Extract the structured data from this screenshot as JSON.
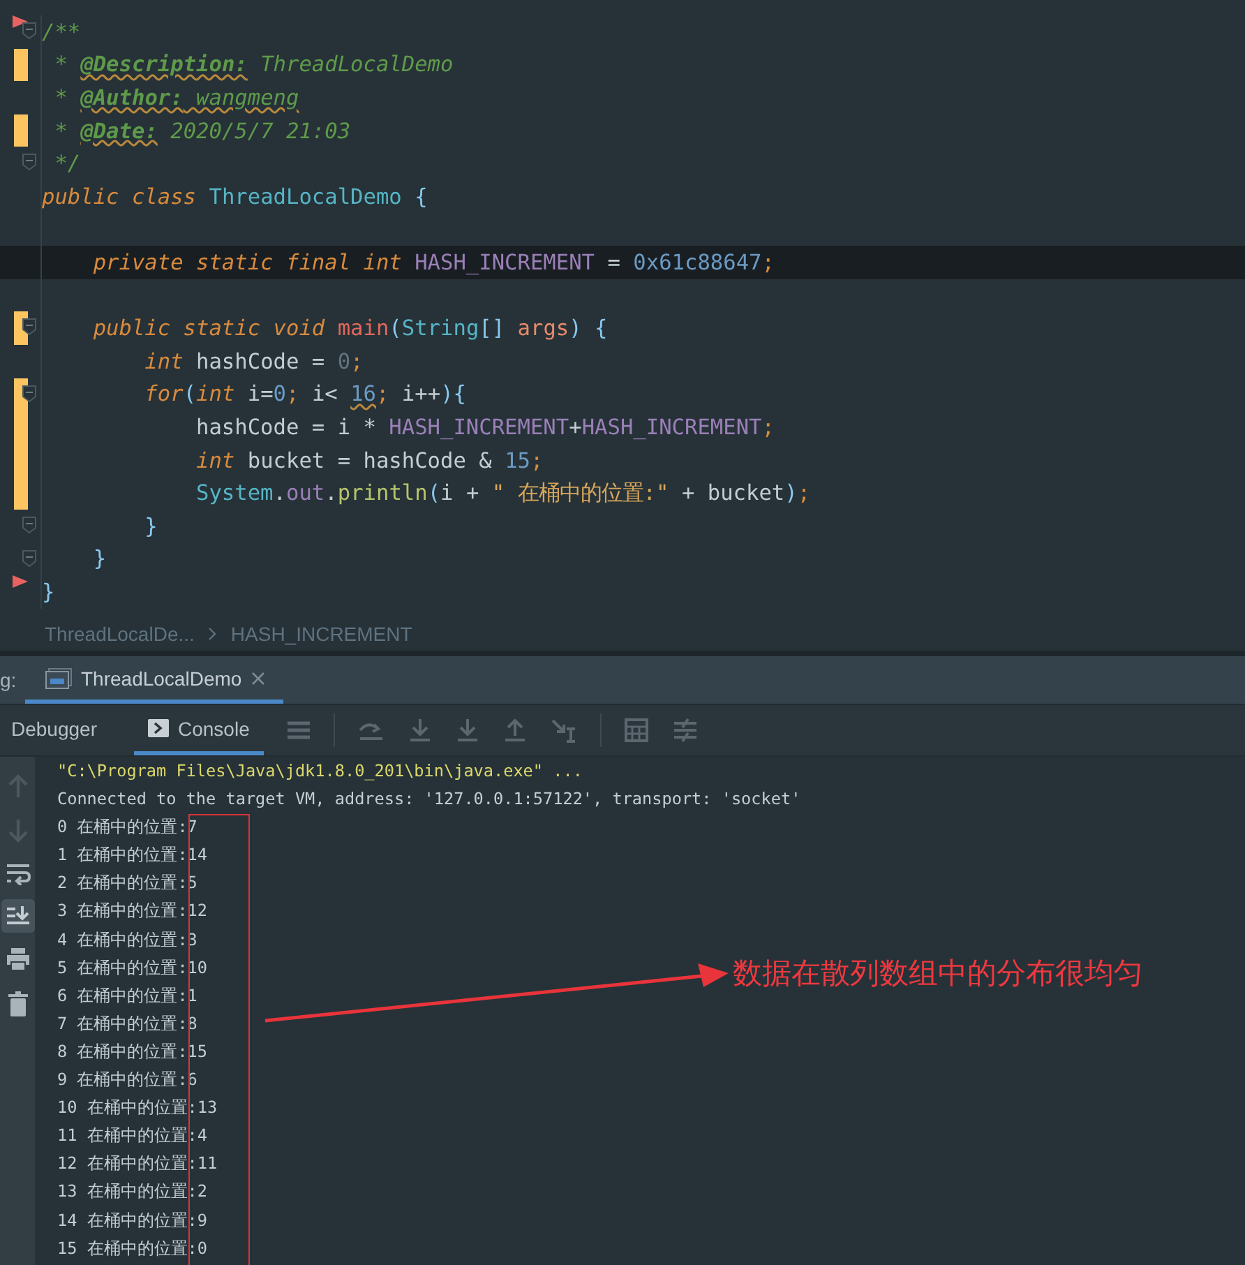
{
  "editor": {
    "lines": [
      {
        "changed": false,
        "fold": true,
        "flag": true,
        "current": false,
        "tokens": [
          {
            "kind": "comment",
            "text": "/**"
          }
        ]
      },
      {
        "changed": true,
        "fold": false,
        "flag": false,
        "current": false,
        "tokens": [
          {
            "kind": "comment",
            "text": " * "
          },
          {
            "kind": "doctag",
            "text": "@Description:"
          },
          {
            "kind": "comment",
            "text": " ThreadLocalDemo"
          }
        ]
      },
      {
        "changed": false,
        "fold": false,
        "flag": false,
        "current": false,
        "tokens": [
          {
            "kind": "comment",
            "text": " * "
          },
          {
            "kind": "doctag",
            "text": "@Author:"
          },
          {
            "kind": "comment-typo",
            "text": " wangmeng"
          }
        ]
      },
      {
        "changed": true,
        "fold": false,
        "flag": false,
        "current": false,
        "tokens": [
          {
            "kind": "comment",
            "text": " * "
          },
          {
            "kind": "doctag",
            "text": "@Date:"
          },
          {
            "kind": "comment",
            "text": " 2020/5/7 21:03"
          }
        ]
      },
      {
        "changed": false,
        "fold": true,
        "flag": false,
        "current": false,
        "tokens": [
          {
            "kind": "comment",
            "text": " */"
          }
        ]
      },
      {
        "changed": false,
        "fold": false,
        "flag": false,
        "current": false,
        "tokens": [
          {
            "kind": "keyword",
            "text": "public class "
          },
          {
            "kind": "class",
            "text": "ThreadLocalDemo"
          },
          {
            "kind": "brace",
            "text": " {"
          }
        ]
      },
      {
        "changed": false,
        "fold": false,
        "flag": false,
        "current": false
      },
      {
        "changed": false,
        "fold": false,
        "flag": false,
        "current": true,
        "tokens": [
          {
            "kind": "keyword",
            "text": "    private static final int "
          },
          {
            "kind": "field",
            "text": "HASH_INCREMENT"
          },
          {
            "kind": "plain",
            "text": " = "
          },
          {
            "kind": "number",
            "text": "0x61c88647"
          },
          {
            "kind": "semi",
            "text": ";"
          }
        ]
      },
      {
        "changed": false,
        "fold": false,
        "flag": false,
        "current": false
      },
      {
        "changed": true,
        "fold": true,
        "flag": false,
        "current": false,
        "tokens": [
          {
            "kind": "keyword",
            "text": "    public static void "
          },
          {
            "kind": "method",
            "text": "main"
          },
          {
            "kind": "brace",
            "text": "("
          },
          {
            "kind": "class",
            "text": "String"
          },
          {
            "kind": "brace",
            "text": "[] "
          },
          {
            "kind": "param",
            "text": "args"
          },
          {
            "kind": "brace",
            "text": ") {"
          }
        ]
      },
      {
        "changed": false,
        "fold": false,
        "flag": false,
        "current": false,
        "tokens": [
          {
            "kind": "keyword",
            "text": "        int "
          },
          {
            "kind": "plain",
            "text": "hashCode = "
          },
          {
            "kind": "unused",
            "text": "0"
          },
          {
            "kind": "semi",
            "text": ";"
          }
        ]
      },
      {
        "changed": true,
        "fold": true,
        "flag": false,
        "current": false,
        "tokens": [
          {
            "kind": "keyword",
            "text": "        for"
          },
          {
            "kind": "brace",
            "text": "("
          },
          {
            "kind": "keyword",
            "text": "int "
          },
          {
            "kind": "plain",
            "text": "i="
          },
          {
            "kind": "number",
            "text": "0"
          },
          {
            "kind": "semi",
            "text": "; "
          },
          {
            "kind": "plain",
            "text": "i< "
          },
          {
            "kind": "number-typo",
            "text": "16"
          },
          {
            "kind": "semi",
            "text": "; "
          },
          {
            "kind": "plain",
            "text": "i++"
          },
          {
            "kind": "brace",
            "text": "){"
          }
        ]
      },
      {
        "changed": true,
        "fold": false,
        "flag": false,
        "current": false,
        "tokens": [
          {
            "kind": "plain",
            "text": "            hashCode = i * "
          },
          {
            "kind": "field",
            "text": "HASH_INCREMENT"
          },
          {
            "kind": "plain",
            "text": "+"
          },
          {
            "kind": "field",
            "text": "HASH_INCREMENT"
          },
          {
            "kind": "semi",
            "text": ";"
          }
        ]
      },
      {
        "changed": true,
        "fold": false,
        "flag": false,
        "current": false,
        "tokens": [
          {
            "kind": "keyword",
            "text": "            int "
          },
          {
            "kind": "plain",
            "text": "bucket = hashCode & "
          },
          {
            "kind": "number",
            "text": "15"
          },
          {
            "kind": "semi",
            "text": ";"
          }
        ]
      },
      {
        "changed": true,
        "fold": false,
        "flag": false,
        "current": false,
        "tokens": [
          {
            "kind": "class",
            "text": "            System"
          },
          {
            "kind": "plain",
            "text": "."
          },
          {
            "kind": "static",
            "text": "out"
          },
          {
            "kind": "plain",
            "text": "."
          },
          {
            "kind": "call",
            "text": "println"
          },
          {
            "kind": "brace",
            "text": "("
          },
          {
            "kind": "plain",
            "text": "i + "
          },
          {
            "kind": "string",
            "text": "\" 在桶中的位置:\""
          },
          {
            "kind": "plain",
            "text": " + bucket"
          },
          {
            "kind": "brace",
            "text": ")"
          },
          {
            "kind": "semi",
            "text": ";"
          }
        ]
      },
      {
        "changed": false,
        "fold": true,
        "flag": false,
        "current": false,
        "tokens": [
          {
            "kind": "brace",
            "text": "        }"
          }
        ]
      },
      {
        "changed": false,
        "fold": true,
        "flag": false,
        "current": false,
        "tokens": [
          {
            "kind": "brace",
            "text": "    }"
          }
        ]
      },
      {
        "changed": false,
        "fold": false,
        "flag": true,
        "current": false,
        "tokens": [
          {
            "kind": "brace",
            "text": "}"
          }
        ]
      }
    ]
  },
  "breadcrumb": [
    "ThreadLocalDe...",
    "HASH_INCREMENT"
  ],
  "tool_window": {
    "label": "g:",
    "tabs": [
      {
        "label": "ThreadLocalDemo",
        "selected": true
      }
    ]
  },
  "debug_tabs": [
    {
      "label": "Debugger",
      "selected": false
    },
    {
      "label": "Console",
      "selected": true
    }
  ],
  "console": {
    "lines": [
      {
        "kind": "command",
        "text": "\"C:\\Program Files\\Java\\jdk1.8.0_201\\bin\\java.exe\" ..."
      },
      {
        "kind": "output",
        "text": "Connected to the target VM, address: '127.0.0.1:57122', transport: 'socket'"
      },
      {
        "kind": "output",
        "text": "0 在桶中的位置:7"
      },
      {
        "kind": "output",
        "text": "1 在桶中的位置:14"
      },
      {
        "kind": "output",
        "text": "2 在桶中的位置:5"
      },
      {
        "kind": "output",
        "text": "3 在桶中的位置:12"
      },
      {
        "kind": "output",
        "text": "4 在桶中的位置:3"
      },
      {
        "kind": "output",
        "text": "5 在桶中的位置:10"
      },
      {
        "kind": "output",
        "text": "6 在桶中的位置:1"
      },
      {
        "kind": "output",
        "text": "7 在桶中的位置:8"
      },
      {
        "kind": "output",
        "text": "8 在桶中的位置:15"
      },
      {
        "kind": "output",
        "text": "9 在桶中的位置:6"
      },
      {
        "kind": "output",
        "text": "10 在桶中的位置:13"
      },
      {
        "kind": "output",
        "text": "11 在桶中的位置:4"
      },
      {
        "kind": "output",
        "text": "12 在桶中的位置:11"
      },
      {
        "kind": "output",
        "text": "13 在桶中的位置:2"
      },
      {
        "kind": "output",
        "text": "14 在桶中的位置:9"
      },
      {
        "kind": "output",
        "text": "15 在桶中的位置:0"
      }
    ]
  },
  "annotation": {
    "text": "数据在散列数组中的分布很均匀"
  }
}
